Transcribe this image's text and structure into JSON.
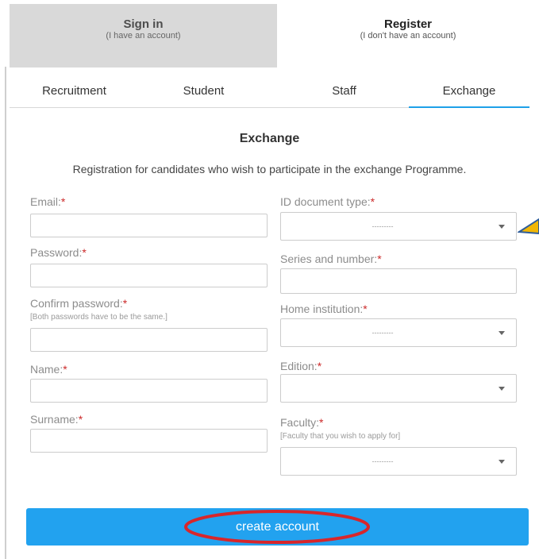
{
  "auth_tabs": {
    "signin": {
      "title": "Sign in",
      "subtitle": "(I have an account)"
    },
    "register": {
      "title": "Register",
      "subtitle": "(I don't have an account)"
    }
  },
  "subtabs": [
    "Recruitment",
    "Student",
    "Staff",
    "Exchange"
  ],
  "active_subtab": "Exchange",
  "section": {
    "title": "Exchange",
    "description": "Registration for candidates who wish to participate in the exchange Programme."
  },
  "required_mark": "*",
  "left_fields": {
    "email": {
      "label": "Email:",
      "value": ""
    },
    "password": {
      "label": "Password:",
      "value": ""
    },
    "confirm_password": {
      "label": "Confirm password:",
      "hint": "[Both passwords have to be the same.]",
      "value": ""
    },
    "name": {
      "label": "Name:",
      "value": ""
    },
    "surname": {
      "label": "Surname:",
      "value": ""
    }
  },
  "right_fields": {
    "id_document_type": {
      "label": "ID document type:",
      "selected": "---------"
    },
    "series_and_number": {
      "label": "Series and number:",
      "value": ""
    },
    "home_institution": {
      "label": "Home institution:",
      "selected": "---------"
    },
    "edition": {
      "label": "Edition:",
      "selected": ""
    },
    "faculty": {
      "label": "Faculty:",
      "hint": "[Faculty that you wish to apply for]",
      "selected": "---------"
    }
  },
  "submit_label": "create account",
  "colors": {
    "accent": "#22a2ef",
    "tab_underline": "#1ea0e8",
    "required": "#cc2a2a",
    "annotation": "#d8262b",
    "signin_bg": "#d9d9d9"
  }
}
